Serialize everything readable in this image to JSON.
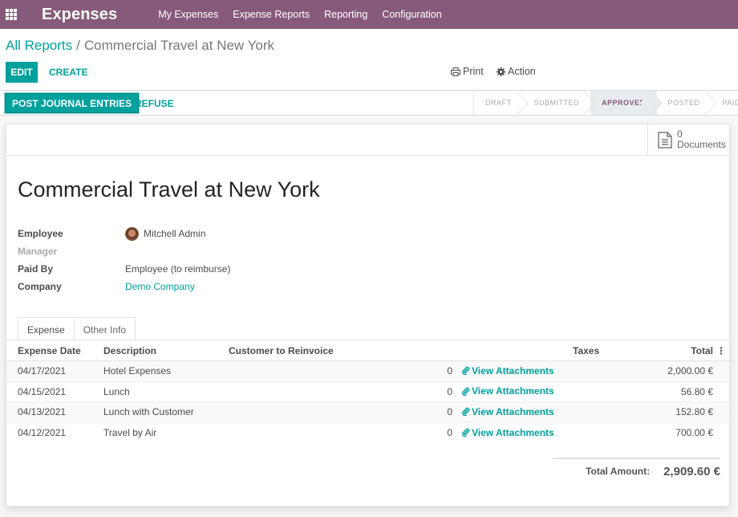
{
  "navbar": {
    "app_name": "Expenses",
    "menu": [
      "My Expenses",
      "Expense Reports",
      "Reporting",
      "Configuration"
    ]
  },
  "breadcrumb": {
    "parent": "All Reports",
    "separator": "/",
    "current": "Commercial Travel at New York"
  },
  "control": {
    "edit_label": "EDIT",
    "create_label": "CREATE",
    "print_label": "Print",
    "action_label": "Action"
  },
  "statusbar": {
    "post_label": "POST JOURNAL ENTRIES",
    "refuse_label": "REFUSE",
    "stages": [
      {
        "label": "DRAFT",
        "active": false
      },
      {
        "label": "SUBMITTED",
        "active": false
      },
      {
        "label": "APPROVED",
        "active": true
      },
      {
        "label": "POSTED",
        "active": false
      },
      {
        "label": "PAID",
        "active": false
      }
    ]
  },
  "sheet": {
    "documents_count": "0",
    "documents_label": "Documents",
    "title": "Commercial Travel at New York",
    "fields": {
      "employee_label": "Employee",
      "employee_value": "Mitchell Admin",
      "manager_label": "Manager",
      "manager_value": "",
      "paid_by_label": "Paid By",
      "paid_by_value": "Employee (to reimburse)",
      "company_label": "Company",
      "company_value": "Demo Company"
    },
    "tabs": [
      {
        "label": "Expense",
        "active": true
      },
      {
        "label": "Other Info",
        "active": false
      }
    ],
    "table": {
      "headers": {
        "date": "Expense Date",
        "description": "Description",
        "customer": "Customer to Reinvoice",
        "taxes": "Taxes",
        "total": "Total"
      },
      "rows": [
        {
          "date": "04/17/2021",
          "description": "Hotel Expenses",
          "customer": "",
          "qty": "0",
          "attachments": "View Attachments",
          "taxes": "",
          "total": "2,000.00 €"
        },
        {
          "date": "04/15/2021",
          "description": "Lunch",
          "customer": "",
          "qty": "0",
          "attachments": "View Attachments",
          "taxes": "",
          "total": "56.80 €"
        },
        {
          "date": "04/13/2021",
          "description": "Lunch with Customer",
          "customer": "",
          "qty": "0",
          "attachments": "View Attachments",
          "taxes": "",
          "total": "152.80 €"
        },
        {
          "date": "04/12/2021",
          "description": "Travel by Air",
          "customer": "",
          "qty": "0",
          "attachments": "View Attachments",
          "taxes": "",
          "total": "700.00 €"
        }
      ]
    },
    "total_amount_label": "Total Amount:",
    "total_amount_value": "2,909.60 €"
  },
  "colors": {
    "brand": "#875a7b",
    "accent": "#00a09d"
  }
}
